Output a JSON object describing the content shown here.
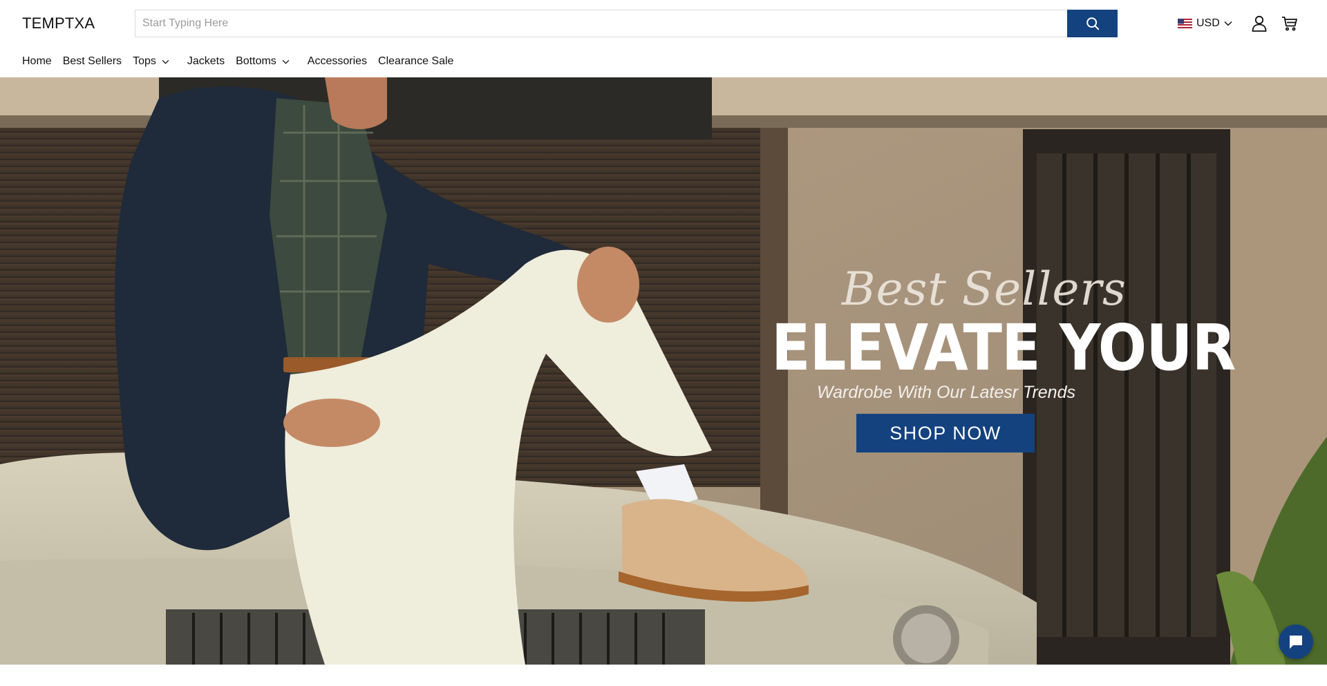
{
  "brand": {
    "logo_text": "TEMPTXA"
  },
  "search": {
    "placeholder": "Start Typing Here",
    "icon": "search-icon"
  },
  "currency": {
    "code": "USD",
    "flag": "us-flag-icon"
  },
  "header_icons": {
    "account": "user-icon",
    "cart": "cart-icon"
  },
  "nav": {
    "items": [
      {
        "label": "Home",
        "has_dropdown": false
      },
      {
        "label": "Best Sellers",
        "has_dropdown": false
      },
      {
        "label": "Tops",
        "has_dropdown": true
      },
      {
        "label": "Jackets",
        "has_dropdown": false
      },
      {
        "label": "Bottoms",
        "has_dropdown": true
      },
      {
        "label": "Accessories",
        "has_dropdown": false
      },
      {
        "label": "Clearance Sale",
        "has_dropdown": false
      }
    ]
  },
  "hero": {
    "script_title": "Best Sellers",
    "headline": "ELEVATE YOUR",
    "subtitle": "Wardrobe With Our Latesr Trends",
    "cta_label": "SHOP NOW"
  },
  "chat": {
    "icon": "chat-bubble-icon"
  },
  "colors": {
    "accent": "#14427f",
    "text": "#111111",
    "background": "#ffffff"
  }
}
